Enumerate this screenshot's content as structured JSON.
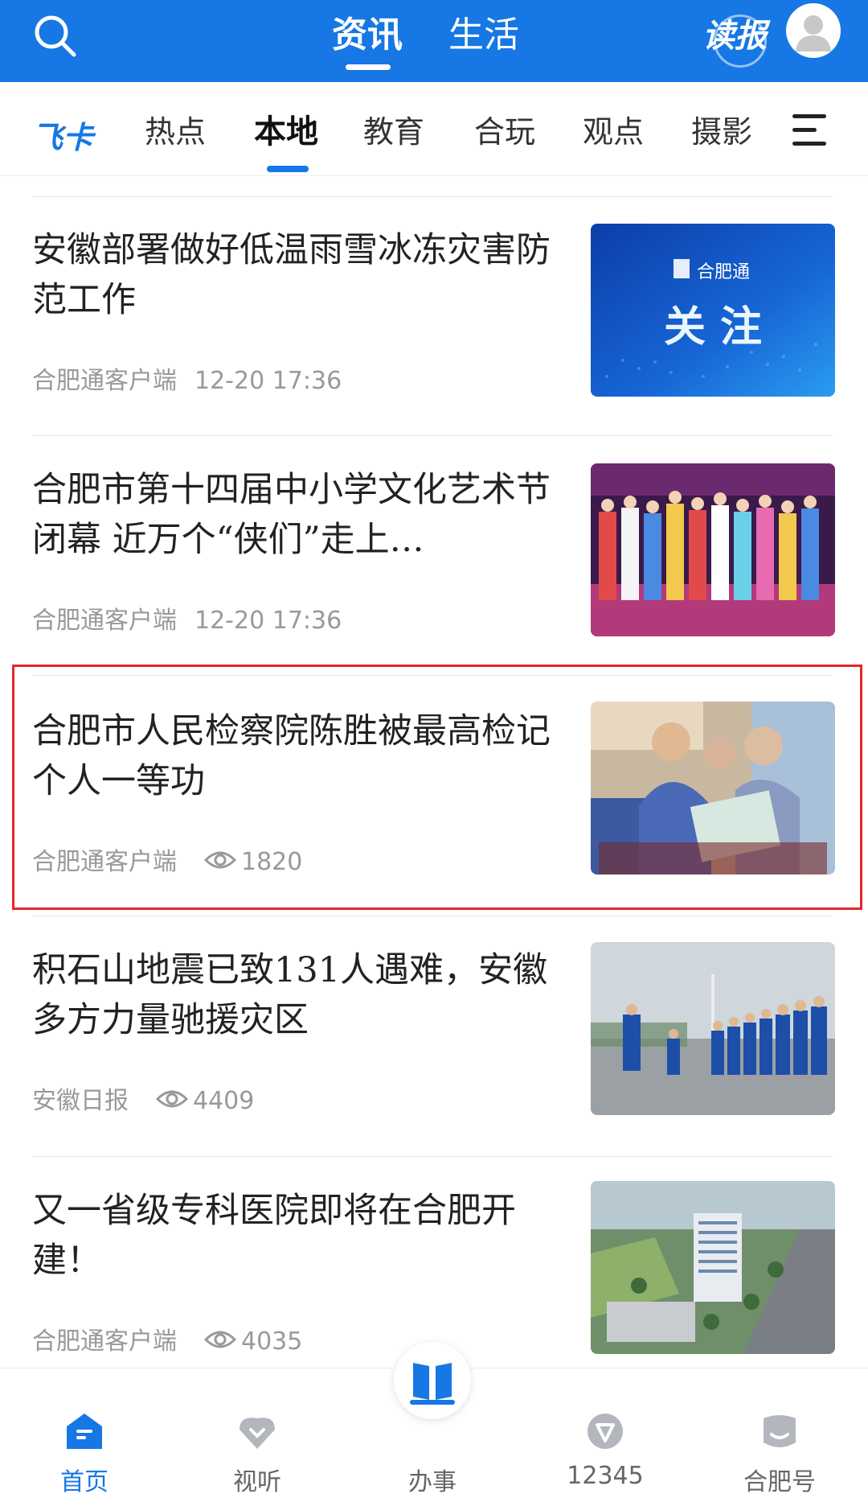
{
  "top_tabs": [
    {
      "label": "资讯",
      "active": true
    },
    {
      "label": "生活",
      "active": false
    }
  ],
  "read_paper_label": "读报",
  "brand_channel": {
    "fei": "飞",
    "ka": "卡"
  },
  "channels": [
    {
      "label": "热点",
      "active": false
    },
    {
      "label": "本地",
      "active": true
    },
    {
      "label": "教育",
      "active": false
    },
    {
      "label": "合玩",
      "active": false
    },
    {
      "label": "观点",
      "active": false
    },
    {
      "label": "摄影",
      "active": false
    }
  ],
  "news": [
    {
      "title": "安徽部署做好低温雨雪冰冻灾害防范工作",
      "source": "合肥通客户端",
      "date": "12-20",
      "time": "17:36",
      "views": null,
      "image": "thumb-focus-banner"
    },
    {
      "title": "合肥市第十四届中小学文化艺术节闭幕 近万个“侠们”走上…",
      "source": "合肥通客户端",
      "date": "12-20",
      "time": "17:36",
      "views": null,
      "image": "thumb-opera-stage"
    },
    {
      "title": "合肥市人民检察院陈胜被最高检记个人一等功",
      "source": "合肥通客户端",
      "date": null,
      "time": null,
      "views": "1820",
      "image": "thumb-prosecutor"
    },
    {
      "title": "积石山地震已致131人遇难，安徽多方力量驰援灾区",
      "source": "安徽日报",
      "date": null,
      "time": null,
      "views": "4409",
      "image": "thumb-rescue-team"
    },
    {
      "title": "又一省级专科医院即将在合肥开建！",
      "source": "合肥通客户端",
      "date": null,
      "time": null,
      "views": "4035",
      "image": "thumb-hospital-aerial"
    }
  ],
  "focus_banner": {
    "brand": "合肥通",
    "text": "关 注"
  },
  "bottom_nav": [
    {
      "label": "首页",
      "icon": "home-icon",
      "active": true
    },
    {
      "label": "视听",
      "icon": "heart-video-icon",
      "active": false
    },
    {
      "label": "办事",
      "icon": "service-book-icon",
      "active": false
    },
    {
      "label": "12345",
      "icon": "hotline-icon",
      "active": false
    },
    {
      "label": "合肥号",
      "icon": "hefei-account-icon",
      "active": false
    }
  ],
  "colors": {
    "brand_blue": "#1677e5",
    "highlight_red": "#e8262a"
  }
}
